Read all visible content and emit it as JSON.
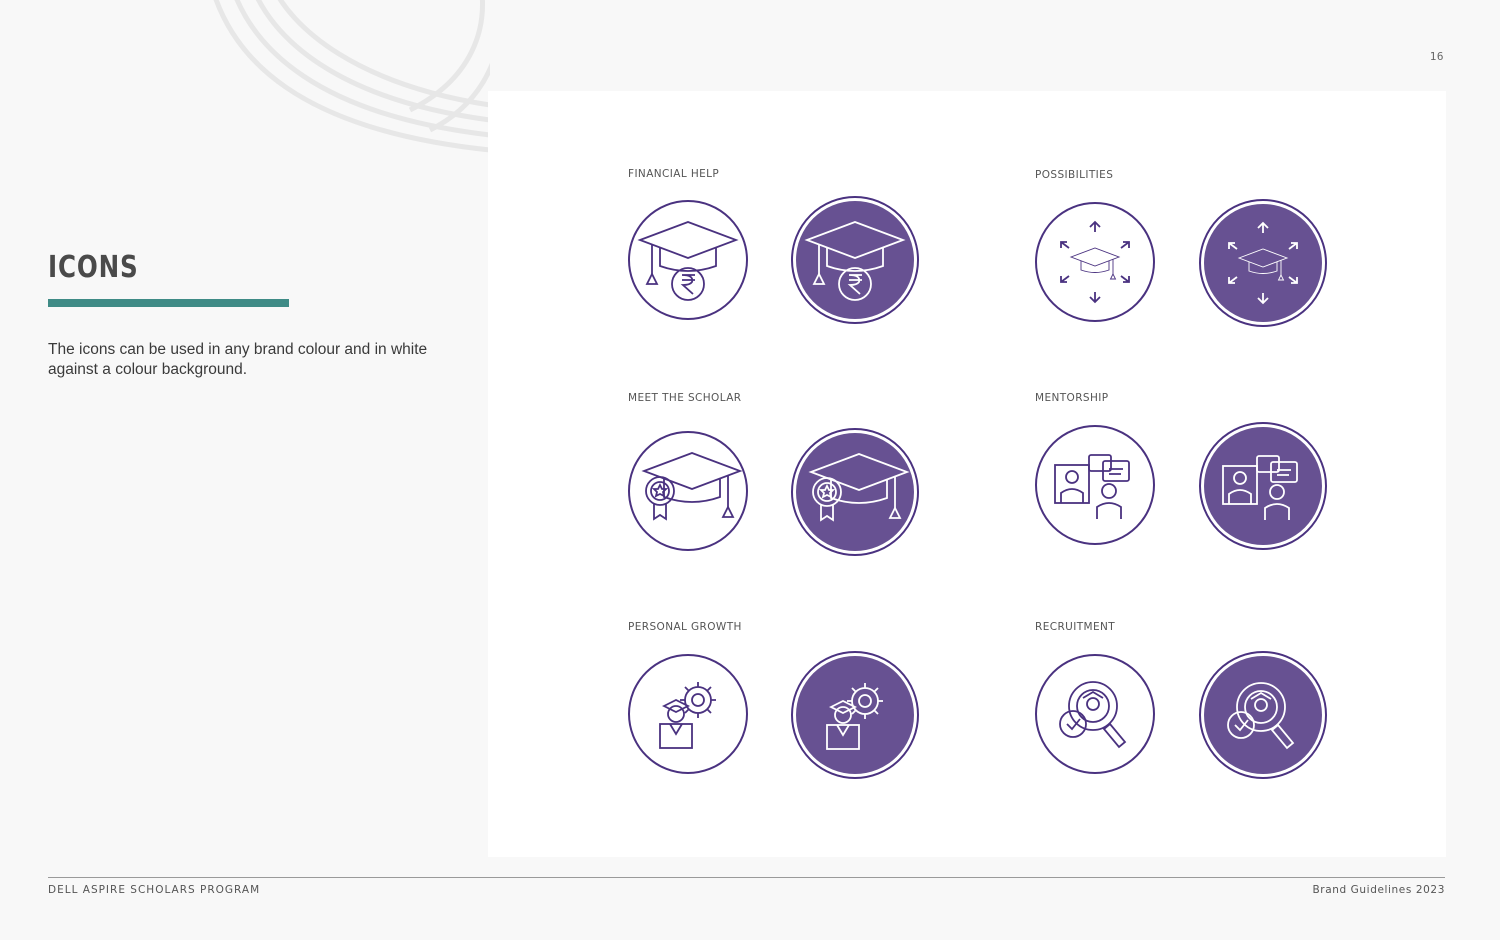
{
  "page": {
    "number": "16"
  },
  "header": {
    "title": "ICONS",
    "description": "The icons can be used in any brand colour and in white against a colour background."
  },
  "colors": {
    "brand_purple": "#5f4b8b",
    "accent_teal": "#3f8b86",
    "text_dark": "#3a3a3a"
  },
  "icon_groups": [
    {
      "label": "FINANCIAL HELP",
      "icon": "graduation-cap-rupee-icon"
    },
    {
      "label": "POSSIBILITIES",
      "icon": "graduation-cap-arrows-icon"
    },
    {
      "label": "MEET THE SCHOLAR",
      "icon": "graduation-cap-badge-icon"
    },
    {
      "label": "MENTORSHIP",
      "icon": "mentorship-chat-icon"
    },
    {
      "label": "PERSONAL GROWTH",
      "icon": "scholar-gear-icon"
    },
    {
      "label": "RECRUITMENT",
      "icon": "recruitment-search-icon"
    }
  ],
  "footer": {
    "left": "DELL ASPIRE SCHOLARS PROGRAM",
    "right": "Brand Guidelines 2023"
  }
}
